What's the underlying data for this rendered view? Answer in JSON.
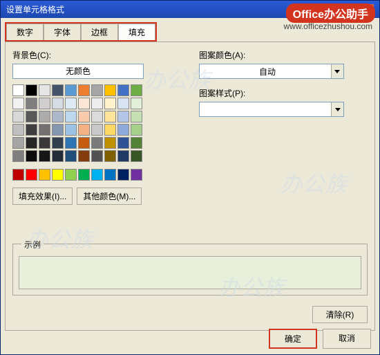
{
  "title": "设置单元格格式",
  "badge_prefix": "Office",
  "badge_suffix": "办公助手",
  "badge_url": "www.officezhushou.com",
  "tabs": [
    "数字",
    "字体",
    "边框",
    "填充"
  ],
  "active_tab": 3,
  "labels": {
    "bgcolor": "背景色(C):",
    "nocolor": "无颜色",
    "pattern_color": "图案颜色(A):",
    "auto": "自动",
    "pattern_style": "图案样式(P):",
    "fill_effect": "填充效果(I)...",
    "more_colors": "其他颜色(M)...",
    "example": "示例",
    "clear": "清除(R)",
    "ok": "确定",
    "cancel": "取消"
  },
  "palette_main": [
    [
      "#ffffff",
      "#000000",
      "#e7e6e6",
      "#44546a",
      "#5b9bd5",
      "#ed7d31",
      "#a5a5a5",
      "#ffc000",
      "#4472c4",
      "#70ad47"
    ],
    [
      "#f2f2f2",
      "#7f7f7f",
      "#d0cece",
      "#d6dce4",
      "#deebf6",
      "#fbe5d5",
      "#ededed",
      "#fff2cc",
      "#d9e2f3",
      "#e2efd9"
    ],
    [
      "#d8d8d8",
      "#595959",
      "#aeabab",
      "#adb9ca",
      "#bdd7ee",
      "#f7cbac",
      "#dbdbdb",
      "#fee599",
      "#b4c6e7",
      "#c5e0b3"
    ],
    [
      "#bfbfbf",
      "#3f3f3f",
      "#757070",
      "#8496b0",
      "#9cc3e5",
      "#f4b183",
      "#c9c9c9",
      "#ffd965",
      "#8eaadb",
      "#a8d08d"
    ],
    [
      "#a5a5a5",
      "#262626",
      "#3a3838",
      "#323f4f",
      "#2e75b5",
      "#c55a11",
      "#7b7b7b",
      "#bf9000",
      "#2f5496",
      "#538135"
    ],
    [
      "#7f7f7f",
      "#0c0c0c",
      "#171616",
      "#222a35",
      "#1e4e79",
      "#833c0b",
      "#525252",
      "#7f6000",
      "#1f3864",
      "#375623"
    ]
  ],
  "palette_standard": [
    [
      "#c00000",
      "#ff0000",
      "#ffc000",
      "#ffff00",
      "#92d050",
      "#00b050",
      "#00b0f0",
      "#0070c0",
      "#002060",
      "#7030a0"
    ]
  ],
  "example_color": "#e8f0db",
  "watermark_text": "办公族"
}
